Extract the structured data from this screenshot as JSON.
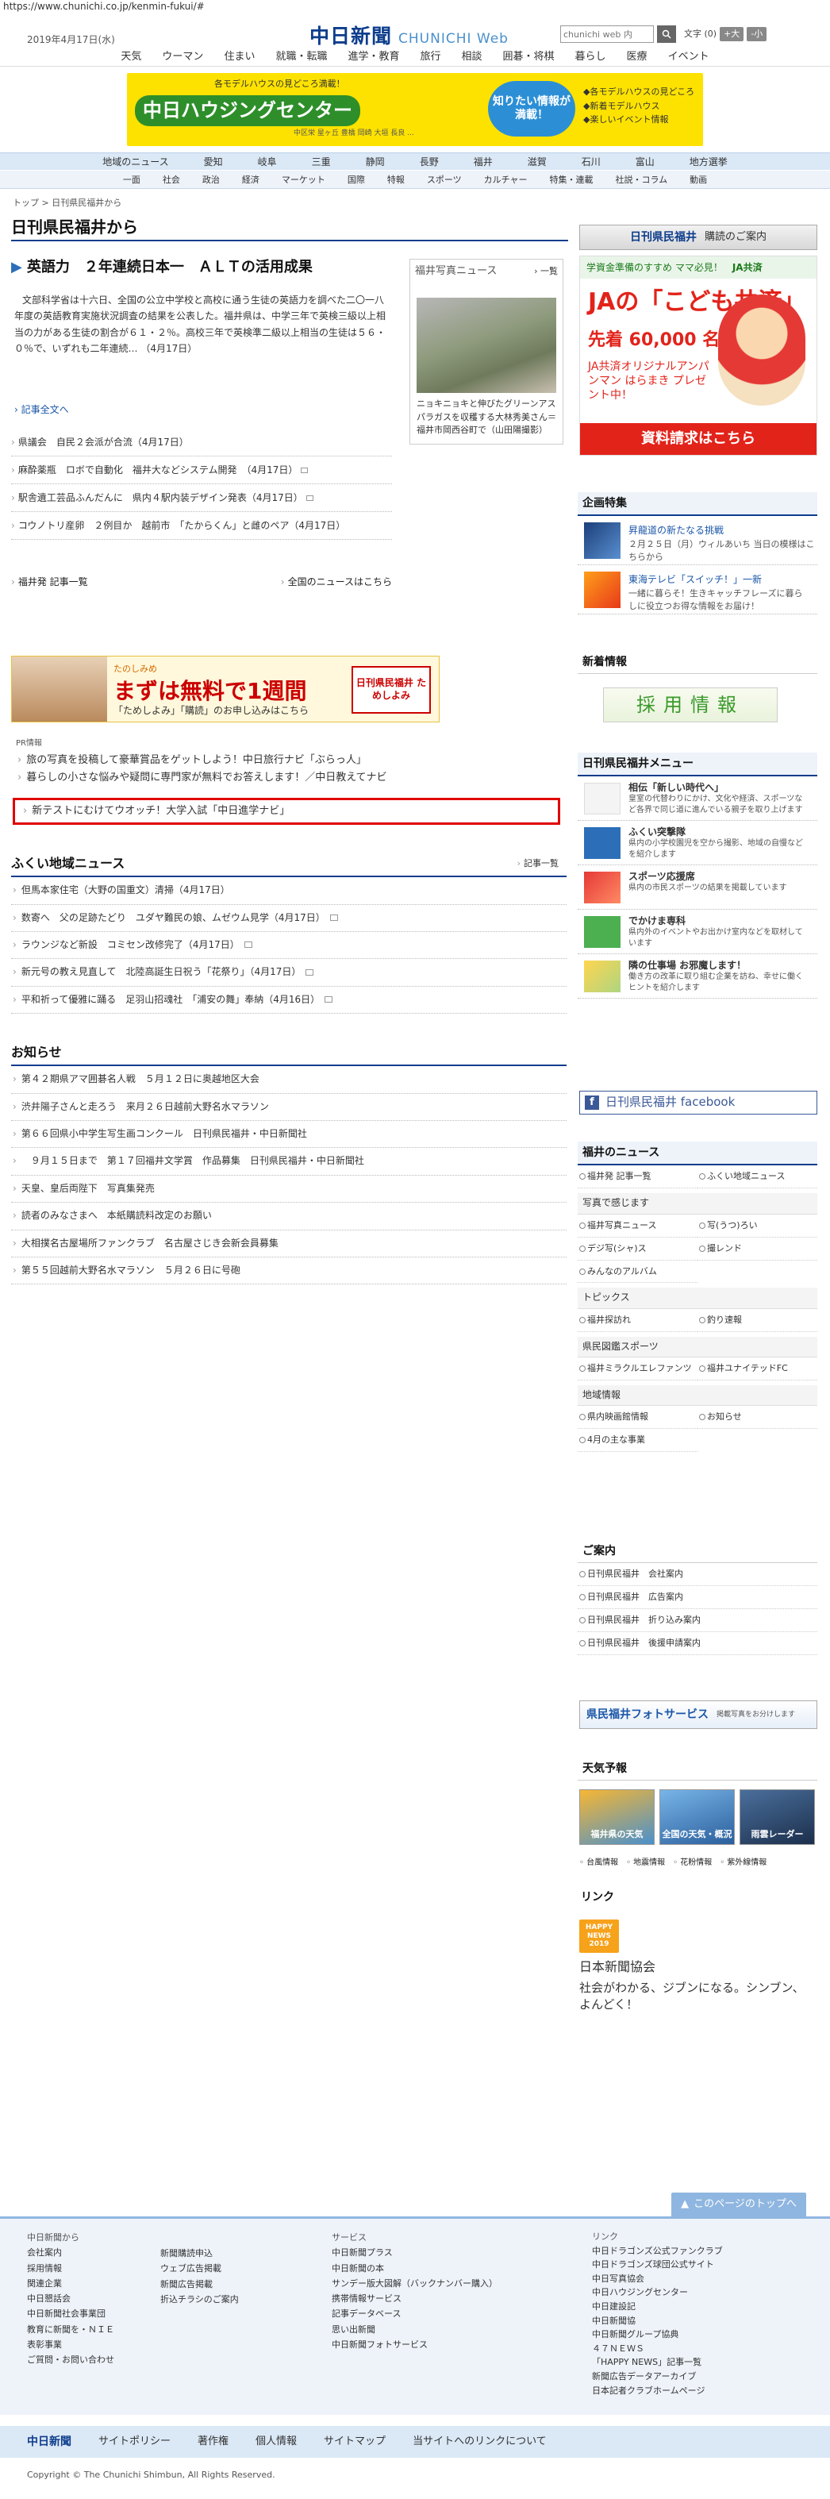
{
  "browser": {
    "url": "https://www.chunichi.co.jp/kenmin-fukui/#"
  },
  "header": {
    "date": "2019年4月17日(水)",
    "logo_kanji": "中日新聞",
    "logo_web": "CHUNICHI Web",
    "search_placeholder": "chunichi web 内",
    "font_label": "文字",
    "font_size": "(0)",
    "font_up": "+大",
    "font_down": "-小"
  },
  "top_nav": [
    "天気",
    "ウーマン",
    "住まい",
    "就職・転職",
    "進学・教育",
    "旅行",
    "相談",
    "囲碁・将棋",
    "暮らし",
    "医療",
    "イベント"
  ],
  "banner_top": {
    "title": "中日ハウジングセンター",
    "sub": "各モデルハウスの見どころ満載！",
    "bubble": "知りたい情報が満載！",
    "list": [
      "◆各モデルハウスの見どころ",
      "◆新着モデルハウス",
      "◆楽しいイベント情報"
    ],
    "small": "中区栄 星ヶ丘 豊橋 岡崎 大垣 長良 ..."
  },
  "region_nav": [
    "地域のニュース",
    "愛知",
    "岐阜",
    "三重",
    "静岡",
    "長野",
    "福井",
    "滋賀",
    "石川",
    "富山",
    "地方選挙"
  ],
  "category_nav": [
    "一面",
    "社会",
    "政治",
    "経済",
    "マーケット",
    "国際",
    "特報",
    "スポーツ",
    "カルチャー",
    "特集・連載",
    "社説・コラム",
    "動画"
  ],
  "breadcrumb": "トップ > 日刊県民福井から",
  "page_title": "日刊県民福井から",
  "lead": {
    "headline": "英語力　２年連続日本一　ＡＬＴの活用成果",
    "body": "文部科学省は十六日、全国の公立中学校と高校に通う生徒の英語力を調べた二〇一八年度の英語教育実施状況調査の結果を公表した。福井県は、中学三年で英検三級以上相当の力がある生徒の割合が６１・２％。高校三年で英検準二級以上相当の生徒は５６・０％で、いずれも二年連続… （4月17日）",
    "more": "記事全文へ"
  },
  "news": [
    "県議会　自民２会派が合流（4月17日）",
    "麻酔薬瓶　ロボで自動化　福井大などシステム開発　（4月17日）",
    "駅舎遺工芸品ふんだんに　県内４駅内装デザイン発表（4月17日）",
    "コウノトリ産卵　２例目か　越前市　「たからくん」と雌のペア（4月17日）"
  ],
  "news_footer": {
    "left": "福井発 記事一覧",
    "right": "全国のニュースはこちら"
  },
  "photo_news": {
    "title": "福井写真ニュース",
    "more": "一覧",
    "caption": "ニョキニョキと伸びたグリーンアスパラガスを収穫する大林秀美さん＝福井市岡西谷町で（山田陽撮影）"
  },
  "ad_mid": {
    "brand": "たのしみめ",
    "main": "まずは無料で1週間",
    "sub": "「ためしよみ」「購読」のお申し込みはこちら",
    "right": "日刊県民福井 ためしよみ"
  },
  "pr": {
    "label": "PR情報",
    "items": [
      "旅の写真を投稿して豪華賞品をゲットしよう！中日旅行ナビ「ぶらっ人」",
      "暮らしの小さな悩みや疑問に専門家が無料でお答えします！／中日教えてナビ"
    ],
    "highlight": "新テストにむけてウオッチ！大学入試「中日進学ナビ」"
  },
  "local": {
    "title": "ふくい地域ニュース",
    "more": "記事一覧",
    "items": [
      "但馬本家住宅（大野の国重文）清掃（4月17日）",
      "数寄へ　父の足跡たどり　ユダヤ難民の娘、ムゼウム見学（4月17日）",
      "ラウンジなど新設　コミセン改修完了（4月17日）",
      "新元号の教え見直して　北陸高誕生日祝う「花祭り」（4月17日）",
      "平和祈って優雅に踊る　足羽山招魂社　「浦安の舞」奉納（4月16日）"
    ]
  },
  "notice": {
    "title": "お知らせ",
    "items": [
      "第４２期県アマ囲碁名人戦　５月１２日に奥越地区大会",
      "渋井陽子さんと走ろう　来月２６日越前大野名水マラソン",
      "第６６回県小中学生写生画コンクール　日刊県民福井・中日新聞社",
      "　９月１５日まで　第１７回福井文学賞　作品募集　日刊県民福井・中日新聞社",
      "天皇、皇后両陛下　写真集発売",
      "読者のみなさまへ　本紙購読料改定のお願い",
      "大相撲名古屋場所ファンクラブ　名古屋さじき会新会員募集",
      "第５５回越前大野名水マラソン　５月２６日に号砲"
    ]
  },
  "right": {
    "banner": {
      "brand": "日刊県民福井",
      "text": "購読のご案内"
    },
    "ad": {
      "top": "学資金準備のすすめ ママ必見！",
      "brand": "JA共済",
      "headline": "JAの「こども共済」",
      "count": "先着 60,000 名様",
      "gift": "JA共済オリジナルアンパンマン はらまき プレゼント中！",
      "button": "資料請求はこちら"
    },
    "features": {
      "title": "企画特集",
      "items": [
        {
          "title": "昇龍道の新たなる挑戦",
          "desc": "２月２５日（月）ウィルあいち 当日の模様はこちらから"
        },
        {
          "title": "東海テレビ「スイッチ！」一新",
          "desc": "一緒に暮らそ！生きキャッチフレーズに暮らしに役立つお得な情報をお届け！"
        }
      ]
    },
    "new_info": {
      "title": "新着情報",
      "recruit": "採用情報"
    },
    "menu": {
      "title": "日刊県民福井メニュー",
      "items": [
        {
          "title": "相伝「新しい時代へ」",
          "desc": "皇室の代替わりにかけ、文化や経済、スポーツなど各界で同じ道に進んでいる親子を取り上げます"
        },
        {
          "title": "ふくい突撃隊",
          "desc": "県内の小学校園児を空から撮影、地域の自慢などを紹介します"
        },
        {
          "title": "スポーツ応援席",
          "desc": "県内の市民スポーツの結果を掲載しています"
        },
        {
          "title": "でかけま専科",
          "desc": "県内外のイベントやお出かけ室内などを取材しています"
        },
        {
          "title": "隣の仕事場 お邪魔します！",
          "desc": "働き方の改革に取り組む企業を訪ね、幸せに働くヒントを紹介します"
        }
      ]
    },
    "facebook": "日刊県民福井 facebook",
    "fukui_news": {
      "title": "福井のニュース",
      "links": [
        "福井発 記事一覧",
        "ふくい地域ニュース"
      ],
      "photo_title": "写真で感じます",
      "photo_links": [
        "福井写真ニュース",
        "写(うつ)ろい",
        "デジ写(シャ)ス",
        "撮レンド",
        "みんなのアルバム"
      ],
      "topics_title": "トピックス",
      "topics_links": [
        "福井探訪れ",
        "釣り速報"
      ],
      "sports_title": "県民図鑑スポーツ",
      "sports_links": [
        "福井ミラクルエレファンツ",
        "福井ユナイテッドFC"
      ],
      "area_title": "地域情報",
      "area_links": [
        "県内映画館情報",
        "お知らせ",
        "4月の主な事業"
      ]
    },
    "guide": {
      "title": "ご案内",
      "items": [
        "日刊県民福井　会社案内",
        "日刊県民福井　広告案内",
        "日刊県民福井　折り込み案内",
        "日刊県民福井　後援申請案内"
      ]
    },
    "photo_service": {
      "title": "県民福井フォトサービス",
      "desc": "掲載写真をお分けします"
    },
    "weather": {
      "title": "天気予報",
      "boxes": [
        "福井県の天気",
        "全国の天気・概況",
        "雨雲レーダー"
      ],
      "links": [
        "台風情報",
        "地震情報",
        "花粉情報",
        "紫外線情報"
      ]
    },
    "link": {
      "title": "リンク",
      "badge": "HAPPY NEWS 2019",
      "org": "日本新聞協会",
      "desc": "社会がわかる、ジブンになる。シンブン、よんどく！"
    }
  },
  "footer": {
    "totop": "このページのトップへ",
    "col1_title": "中日新聞から",
    "col1": [
      "会社案内",
      "採用情報",
      "関連企業",
      "中日懇話会",
      "中日新聞社会事業団",
      "教育に新聞を・ＮＩＥ",
      "表彰事業",
      "ご質問・お問い合わせ"
    ],
    "col2": [
      "新聞購読申込",
      "ウェブ広告掲載",
      "新聞広告掲載",
      "折込チラシのご案内"
    ],
    "col3_title": "サービス",
    "col3": [
      "中日新聞プラス",
      "中日新聞の本",
      "サンデー版大図解（バックナンバー購入）",
      "携帯情報サービス",
      "記事データベース",
      "思い出新聞",
      "中日新聞フォトサービス"
    ],
    "col4_title": "リンク",
    "col4": [
      "中日ドラゴンズ公式ファンクラブ",
      "中日ドラゴンズ球団公式サイト",
      "中日写真協会",
      "中日ハウジングセンター",
      "中日建設記",
      "中日新聞協",
      "中日新聞グループ協典",
      "４７ＮＥＷＳ",
      "「HAPPY NEWS」記事一覧",
      "新聞広告データアーカイブ",
      "日本記者クラブホームページ"
    ],
    "bar_logo": "中日新聞",
    "bar": [
      "サイトポリシー",
      "著作権",
      "個人情報",
      "サイトマップ",
      "当サイトへのリンクについて"
    ],
    "copyright": "Copyright © The Chunichi Shimbun, All Rights Reserved."
  }
}
